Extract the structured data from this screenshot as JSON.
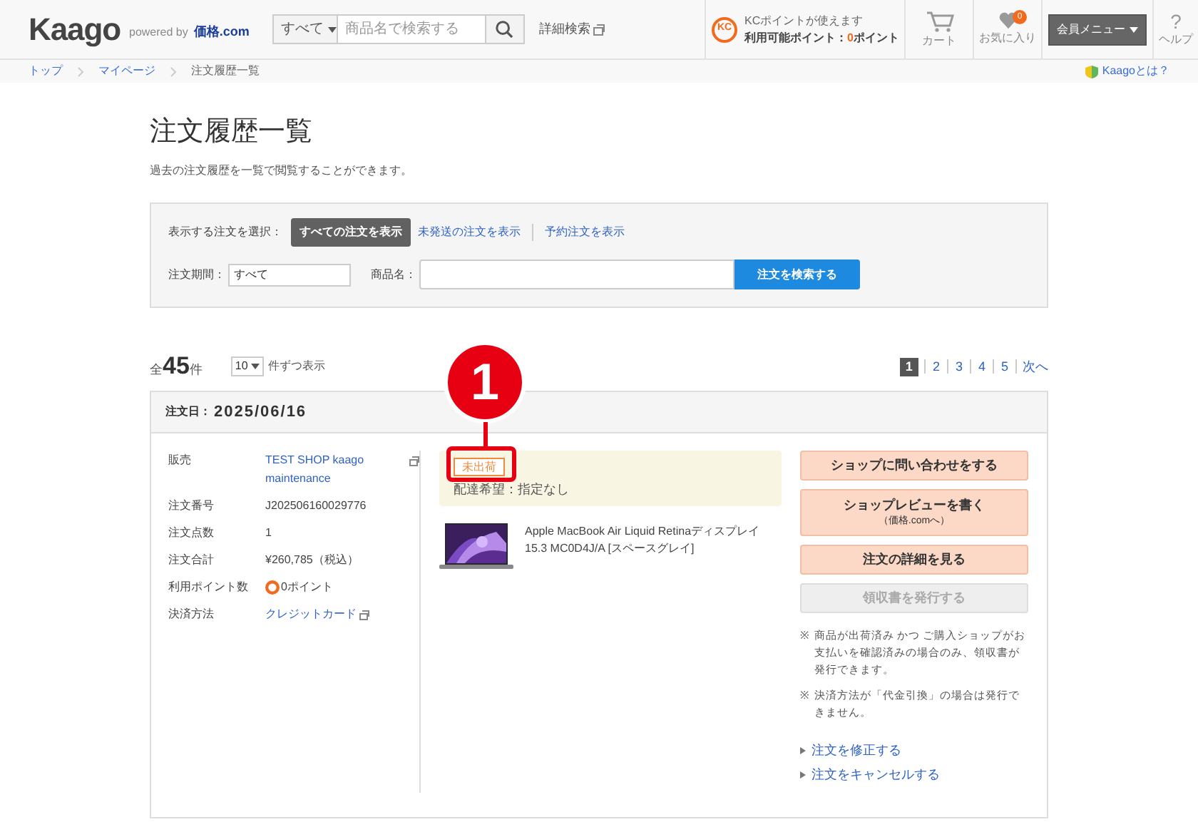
{
  "header": {
    "logo": "Kaago",
    "powered_by": "powered by",
    "partner": "価格.com",
    "search": {
      "category": "すべて",
      "placeholder": "商品名で検索する"
    },
    "advanced_search": "詳細検索",
    "points": {
      "badge": "KC",
      "notice": "KCポイントが使えます",
      "label": "利用可能ポイント：",
      "value": "0",
      "unit": "ポイント"
    },
    "cart": "カート",
    "favorites": {
      "label": "お気に入り",
      "count": "0"
    },
    "member_menu": "会員メニュー",
    "help": {
      "mark": "?",
      "label": "ヘルプ"
    }
  },
  "breadcrumb": [
    "トップ",
    "マイページ",
    "注文履歴一覧"
  ],
  "about_link": "Kaagoとは？",
  "page": {
    "title": "注文履歴一覧",
    "description": "過去の注文履歴を一覧で閲覧することができます。"
  },
  "filter": {
    "label": "表示する注文を選択：",
    "options": [
      {
        "label": "すべての注文を表示",
        "selected": true
      },
      {
        "label": "未発送の注文を表示",
        "selected": false
      },
      {
        "label": "予約注文を表示",
        "selected": false
      }
    ],
    "period_label": "注文期間：",
    "period_value": "すべて",
    "product_label": "商品名：",
    "search_button": "注文を検索する"
  },
  "results": {
    "total_prefix": "全",
    "total": "45",
    "total_suffix": "件",
    "per_page": "10",
    "per_page_suffix": "件ずつ表示",
    "pages": [
      {
        "label": "1",
        "selected": true
      },
      {
        "label": "2",
        "selected": false
      },
      {
        "label": "3",
        "selected": false
      },
      {
        "label": "4",
        "selected": false
      },
      {
        "label": "5",
        "selected": false
      }
    ],
    "next": "次へ"
  },
  "order": {
    "date_label": "注文日：",
    "date": "2025/06/16",
    "details": [
      {
        "label": "販売",
        "value": "TEST SHOP kaago maintenance",
        "kind": "link"
      },
      {
        "label": "注文番号",
        "value": "J202506160029776",
        "kind": "text"
      },
      {
        "label": "注文点数",
        "value": "1",
        "kind": "text"
      },
      {
        "label": "注文合計",
        "value": "¥260,785（税込）",
        "kind": "text"
      },
      {
        "label": "利用ポイント数",
        "value": "0ポイント",
        "kind": "points"
      },
      {
        "label": "決済方法",
        "value": "クレジットカード",
        "kind": "link"
      }
    ],
    "status": "未出荷",
    "delivery": "配達希望：指定なし",
    "product": {
      "name": "Apple MacBook Air Liquid Retinaディスプレイ 15.3 MC0D4J/A [スペースグレイ]"
    },
    "actions": [
      {
        "label": "ショップに問い合わせをする",
        "disabled": false
      },
      {
        "label": "ショップレビューを書く",
        "sub": "（価格.comへ）",
        "disabled": false
      },
      {
        "label": "注文の詳細を見る",
        "disabled": false
      },
      {
        "label": "領収書を発行する",
        "disabled": true
      }
    ],
    "notes": [
      "商品が出荷済み かつ ご購入ショップがお支払いを確認済みの場合のみ、領収書が発行できます。",
      "決済方法が「代金引換」の場合は発行できません。"
    ],
    "note_mark": "※",
    "links": [
      "注文を修正する",
      "注文をキャンセルする"
    ]
  },
  "callout": {
    "label": "1"
  }
}
